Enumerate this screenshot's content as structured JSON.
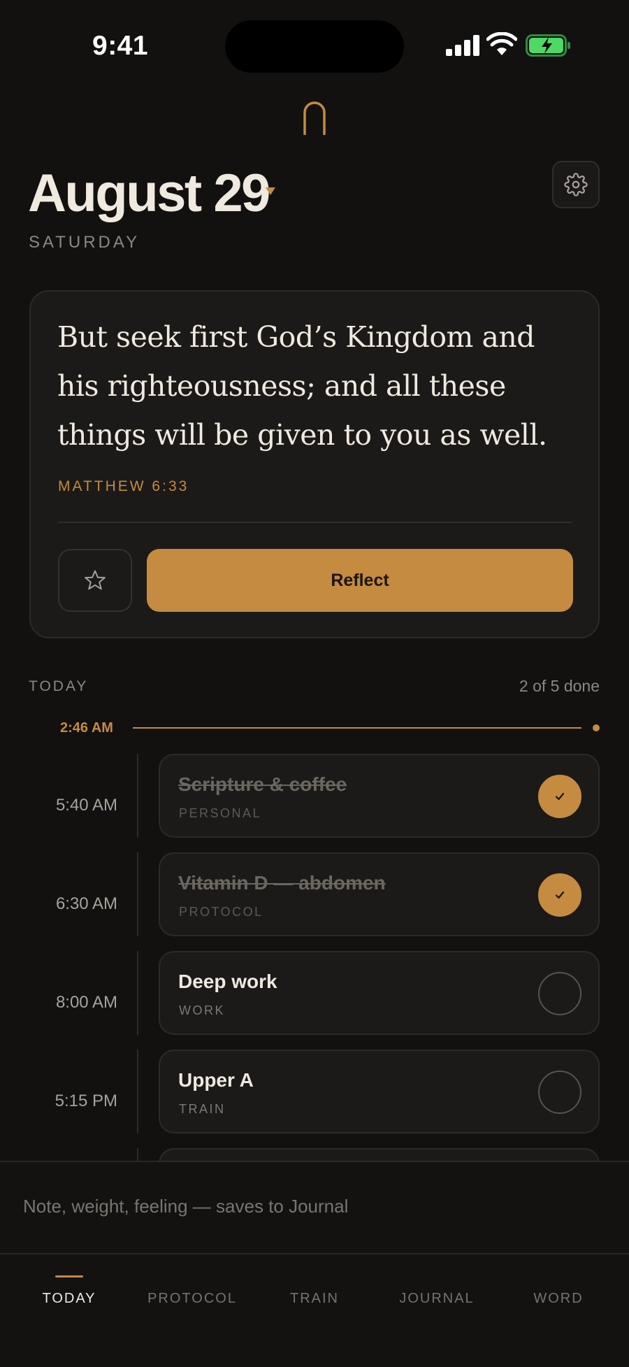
{
  "status_bar": {
    "time": "9:41"
  },
  "header": {
    "date": "August 29",
    "weekday": "SATURDAY"
  },
  "verse": {
    "text": "But seek first God’s Kingdom and his righteousness; and all these things will be given to you as well.",
    "reference": "MATTHEW 6:33",
    "reflect_label": "Reflect"
  },
  "today": {
    "label": "TODAY",
    "progress": "2 of 5 done",
    "now_time": "2:46 AM",
    "tasks": [
      {
        "time": "5:40 AM",
        "title": "Scripture & coffee",
        "category": "PERSONAL",
        "done": true
      },
      {
        "time": "6:30 AM",
        "title": "Vitamin D — abdomen",
        "category": "PROTOCOL",
        "done": true
      },
      {
        "time": "8:00 AM",
        "title": "Deep work",
        "category": "WORK",
        "done": false
      },
      {
        "time": "5:15 PM",
        "title": "Upper A",
        "category": "TRAIN",
        "done": false
      }
    ]
  },
  "note": {
    "placeholder": "Note, weight, feeling — saves to Journal"
  },
  "tabs": [
    {
      "label": "TODAY",
      "active": true
    },
    {
      "label": "PROTOCOL",
      "active": false
    },
    {
      "label": "TRAIN",
      "active": false
    },
    {
      "label": "JOURNAL",
      "active": false
    },
    {
      "label": "WORD",
      "active": false
    }
  ],
  "colors": {
    "accent": "#c58b40",
    "background": "#121110",
    "card": "#1b1a18",
    "battery": "#4cd964"
  }
}
